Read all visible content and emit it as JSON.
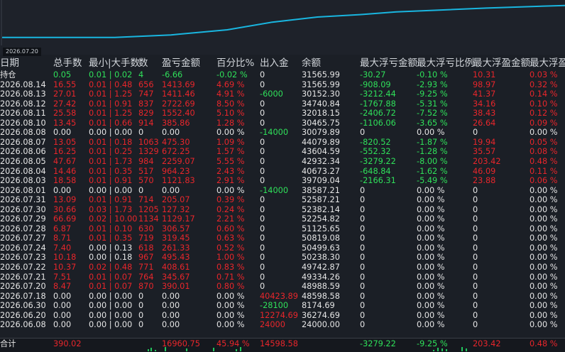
{
  "colors": {
    "red": "#e8262b",
    "green": "#2fe05a",
    "white": "#e6e6e6",
    "line": "#19b6e0"
  },
  "equity_chart": {
    "date_label": "2026.07.20",
    "series": [
      {
        "t": 0.0,
        "v": 24000.0
      },
      {
        "t": 0.2,
        "v": 24000.0
      },
      {
        "t": 0.3,
        "v": 26000.0
      },
      {
        "t": 0.4,
        "v": 30000.0
      },
      {
        "t": 0.48,
        "v": 36000.0
      },
      {
        "t": 0.56,
        "v": 40000.0
      },
      {
        "t": 0.64,
        "v": 42000.0
      },
      {
        "t": 0.7,
        "v": 44000.0
      },
      {
        "t": 0.78,
        "v": 45500.0
      },
      {
        "t": 0.86,
        "v": 47000.0
      },
      {
        "t": 0.94,
        "v": 48200.0
      },
      {
        "t": 1.0,
        "v": 48988.59
      }
    ],
    "ylim": [
      20000,
      50000
    ]
  },
  "headers": [
    "日期",
    "总手数",
    "最小|大手数",
    "数",
    "盈亏金额",
    "百分比%",
    "出入金",
    "余额",
    "最大浮亏金额",
    "最大浮亏比例",
    "最大浮盈金额",
    "最大浮盈比例"
  ],
  "rows": [
    [
      "持仓",
      "0.05",
      "0.01 | 0.02",
      "4",
      "-6.66",
      "-0.02 %",
      "0",
      "31565.99",
      "-30.27",
      "-0.10 %",
      "10.31",
      "0.03 %"
    ],
    [
      "2026.08.14",
      "16.55",
      "0.01 | 0.48",
      "656",
      "1413.69",
      "4.69 %",
      "0",
      "31565.99",
      "-908.09",
      "-2.93 %",
      "98.97",
      "0.32 %"
    ],
    [
      "2026.08.13",
      "27.01",
      "0.01 | 1.25",
      "747",
      "1411.46",
      "4.91 %",
      "-6000",
      "30152.30",
      "-3212.44",
      "-9.25 %",
      "41.37",
      "0.14 %"
    ],
    [
      "2026.08.12",
      "27.42",
      "0.01 | 0.91",
      "837",
      "2722.69",
      "8.50 %",
      "0",
      "34740.84",
      "-1767.88",
      "-5.31 %",
      "34.16",
      "0.10 %"
    ],
    [
      "2026.08.11",
      "25.58",
      "0.01 | 1.25",
      "829",
      "1552.40",
      "5.10 %",
      "0",
      "32018.15",
      "-2406.72",
      "-7.52 %",
      "38.43",
      "0.12 %"
    ],
    [
      "2026.08.10",
      "13.45",
      "0.01 | 0.66",
      "914",
      "385.86",
      "1.28 %",
      "0",
      "30465.75",
      "-1106.06",
      "-3.65 %",
      "26.64",
      "0.09 %"
    ],
    [
      "2026.08.08",
      "0.00",
      "0.00 | 0.00",
      "0",
      "0.00",
      "0.00 %",
      "-14000",
      "30079.89",
      "0",
      "0.00 %",
      "0",
      "0.00 %"
    ],
    [
      "2026.08.07",
      "13.05",
      "0.01 | 0.18",
      "1063",
      "475.30",
      "1.09 %",
      "0",
      "44079.89",
      "-820.52",
      "-1.87 %",
      "19.94",
      "0.05 %"
    ],
    [
      "2026.08.06",
      "16.25",
      "0.01 | 0.25",
      "1329",
      "672.25",
      "1.57 %",
      "0",
      "43604.59",
      "-552.32",
      "-1.28 %",
      "35.57",
      "0.08 %"
    ],
    [
      "2026.08.05",
      "47.67",
      "0.01 | 1.73",
      "984",
      "2259.07",
      "5.55 %",
      "0",
      "42932.34",
      "-3279.22",
      "-8.00 %",
      "203.42",
      "0.48 %"
    ],
    [
      "2026.08.04",
      "14.46",
      "0.01 | 0.35",
      "517",
      "964.23",
      "2.43 %",
      "0",
      "40673.27",
      "-648.84",
      "-1.62 %",
      "46.09",
      "0.11 %"
    ],
    [
      "2026.08.03",
      "18.58",
      "0.01 | 0.91",
      "570",
      "1121.83",
      "2.91 %",
      "0",
      "39709.04",
      "-2166.31",
      "-5.49 %",
      "23.88",
      "0.06 %"
    ],
    [
      "2026.08.01",
      "0.00",
      "0.00 | 0.00",
      "0",
      "0.00",
      "0.00 %",
      "-14000",
      "38587.21",
      "0",
      "0.00 %",
      "0",
      "0.00 %"
    ],
    [
      "2026.07.31",
      "13.09",
      "0.01 | 0.91",
      "714",
      "205.07",
      "0.39 %",
      "0",
      "52587.21",
      "0",
      "0.00 %",
      "0",
      "0.00 %"
    ],
    [
      "2026.07.30",
      "30.66",
      "0.03 | 1.73",
      "1205",
      "127.32",
      "0.24 %",
      "0",
      "52382.14",
      "0",
      "0.00 %",
      "0",
      "0.00 %"
    ],
    [
      "2026.07.29",
      "66.69",
      "0.02 | 10.00",
      "1134",
      "1129.17",
      "2.21 %",
      "0",
      "52254.82",
      "0",
      "0.00 %",
      "0",
      "0.00 %"
    ],
    [
      "2026.07.28",
      "6.87",
      "0.01 | 0.10",
      "630",
      "306.57",
      "0.60 %",
      "0",
      "51125.65",
      "0",
      "0.00 %",
      "0",
      "0.00 %"
    ],
    [
      "2026.07.27",
      "8.71",
      "0.01 | 0.35",
      "719",
      "319.45",
      "0.63 %",
      "0",
      "50819.08",
      "0",
      "0.00 %",
      "0",
      "0.00 %"
    ],
    [
      "2026.07.24",
      "7.40",
      "0.00 | 0.13",
      "618",
      "261.33",
      "0.52 %",
      "0",
      "50499.63",
      "0",
      "0.00 %",
      "0",
      "0.00 %"
    ],
    [
      "2026.07.23",
      "10.18",
      "0.00 | 0.18",
      "967",
      "495.43",
      "1.00 %",
      "0",
      "50238.30",
      "0",
      "0.00 %",
      "0",
      "0.00 %"
    ],
    [
      "2026.07.22",
      "10.37",
      "0.02 | 0.48",
      "771",
      "408.61",
      "0.83 %",
      "0",
      "49742.87",
      "0",
      "0.00 %",
      "0",
      "0.00 %"
    ],
    [
      "2026.07.21",
      "7.51",
      "0.01 | 0.07",
      "764",
      "345.67",
      "0.71 %",
      "0",
      "49334.26",
      "0",
      "0.00 %",
      "0",
      "0.00 %"
    ],
    [
      "2026.07.20",
      "8.47",
      "0.01 | 0.07",
      "870",
      "390.01",
      "0.80 %",
      "0",
      "48988.59",
      "0",
      "0.00 %",
      "0",
      "0.00 %"
    ],
    [
      "2026.07.18",
      "0.00",
      "0.00 | 0.00",
      "0",
      "0.00",
      "0.00 %",
      "40423.89",
      "48598.58",
      "0",
      "0.00 %",
      "0",
      "0.00 %"
    ],
    [
      "2026.06.30",
      "0.00",
      "0.00 | 0.00",
      "0",
      "0.00",
      "0.00 %",
      "-28100",
      "8174.69",
      "0",
      "0.00 %",
      "0",
      "0.00 %"
    ],
    [
      "2026.06.20",
      "0.00",
      "0.00 | 0.00",
      "0",
      "0.00",
      "0.00 %",
      "12274.69",
      "36274.69",
      "0",
      "0.00 %",
      "0",
      "0.00 %"
    ],
    [
      "2026.06.08",
      "0.00",
      "0.00 | 0.00",
      "0",
      "0.00",
      "0.00 %",
      "24000",
      "24000.00",
      "0",
      "0.00 %",
      "0",
      "0.00 %"
    ]
  ],
  "footer": [
    "合计",
    "390.02",
    "",
    "",
    "16960.75",
    "45.94 %",
    "14598.58",
    "",
    "-3279.22",
    "-9.25 %",
    "203.42",
    "0.48 %"
  ],
  "volume_bars": [
    3,
    5,
    2,
    6,
    4,
    5,
    3,
    6,
    2,
    5,
    4,
    3,
    6,
    4
  ]
}
